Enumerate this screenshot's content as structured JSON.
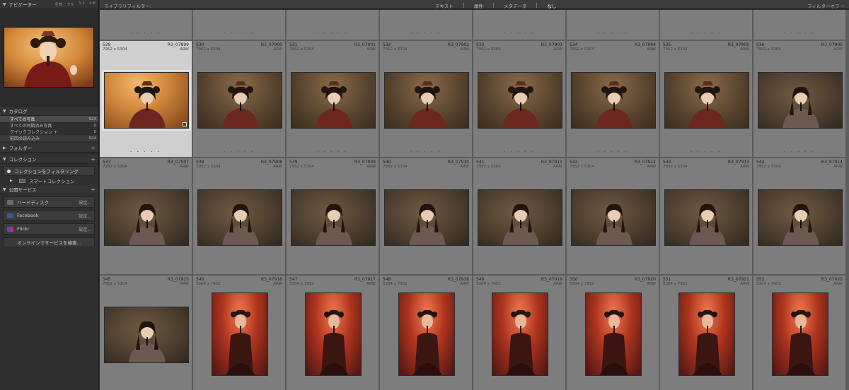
{
  "navigator": {
    "title": "ナビゲーター",
    "options": [
      "全体",
      "フル",
      "1:1",
      "1:8"
    ]
  },
  "catalog": {
    "title": "カタログ",
    "items": [
      {
        "label": "すべての写真",
        "count": "924"
      },
      {
        "label": "すべての同期済み写真",
        "count": "0"
      },
      {
        "label": "クイックコレクション +",
        "count": "0"
      },
      {
        "label": "前回の読み込み",
        "count": "924"
      }
    ]
  },
  "folders": {
    "title": "フォルダー"
  },
  "collections": {
    "title": "コレクション",
    "filter_label": "コレクションをフィルタリング",
    "smart_label": "スマートコレクション"
  },
  "publish": {
    "title": "公開サービス",
    "services": [
      {
        "name": "ハードディスク",
        "setting": "設定...",
        "icon": "hard-disk-icon",
        "color": "#6a6a6a"
      },
      {
        "name": "Facebook",
        "setting": "設定...",
        "icon": "facebook-icon",
        "color": "#3b5998"
      },
      {
        "name": "Flickr",
        "setting": "設定...",
        "icon": "flickr-icon",
        "color": "#d0247a"
      }
    ],
    "find_label": "オンラインでサービスを検索..."
  },
  "filterbar": {
    "title": "ライブラリフィルター:",
    "tabs": [
      "テキスト",
      "属性",
      "メタデータ",
      "なし"
    ],
    "active_tab": "なし",
    "right_label": "フィルターオフ ÷"
  },
  "grid": {
    "columns": 8,
    "rows": [
      [
        {
          "index": "529",
          "name": "R3_07899",
          "dims": "7952 x 5304",
          "ext": "ARW",
          "orientation": "landscape",
          "tone": "hero",
          "selected": true
        },
        {
          "index": "530",
          "name": "R3_07900",
          "dims": "7952 x 5304",
          "ext": "ARW",
          "orientation": "landscape",
          "tone": "warm"
        },
        {
          "index": "531",
          "name": "R3_07901",
          "dims": "7952 x 5304",
          "ext": "ARW",
          "orientation": "landscape",
          "tone": "warm"
        },
        {
          "index": "532",
          "name": "R3_07902",
          "dims": "7952 x 5304",
          "ext": "ARW",
          "orientation": "landscape",
          "tone": "warm"
        },
        {
          "index": "533",
          "name": "R3_07903",
          "dims": "7952 x 5304",
          "ext": "ARW",
          "orientation": "landscape",
          "tone": "warm"
        },
        {
          "index": "534",
          "name": "R3_07904",
          "dims": "7952 x 5304",
          "ext": "ARW",
          "orientation": "landscape",
          "tone": "warm"
        },
        {
          "index": "535",
          "name": "R3_07905",
          "dims": "7952 x 5304",
          "ext": "ARW",
          "orientation": "landscape",
          "tone": "warm"
        },
        {
          "index": "536",
          "name": "R3_07906",
          "dims": "7952 x 5304",
          "ext": "ARW",
          "orientation": "landscape",
          "tone": "stage"
        }
      ],
      [
        {
          "index": "537",
          "name": "R3_07907",
          "dims": "7952 x 5304",
          "ext": "ARW",
          "orientation": "landscape",
          "tone": "stage"
        },
        {
          "index": "538",
          "name": "R3_07908",
          "dims": "7952 x 5304",
          "ext": "ARW",
          "orientation": "landscape",
          "tone": "stage"
        },
        {
          "index": "539",
          "name": "R3_07909",
          "dims": "7952 x 5304",
          "ext": "ARW",
          "orientation": "landscape",
          "tone": "stage"
        },
        {
          "index": "540",
          "name": "R3_07910",
          "dims": "7952 x 5304",
          "ext": "ARW",
          "orientation": "landscape",
          "tone": "stage"
        },
        {
          "index": "541",
          "name": "R3_07911",
          "dims": "7952 x 5304",
          "ext": "ARW",
          "orientation": "landscape",
          "tone": "stage"
        },
        {
          "index": "542",
          "name": "R3_07912",
          "dims": "7952 x 5304",
          "ext": "ARW",
          "orientation": "landscape",
          "tone": "stage"
        },
        {
          "index": "543",
          "name": "R3_07913",
          "dims": "7952 x 5304",
          "ext": "ARW",
          "orientation": "landscape",
          "tone": "stage"
        },
        {
          "index": "544",
          "name": "R3_07914",
          "dims": "7952 x 5304",
          "ext": "ARW",
          "orientation": "landscape",
          "tone": "stage"
        }
      ],
      [
        {
          "index": "545",
          "name": "R3_07915",
          "dims": "7952 x 5304",
          "ext": "ARW",
          "orientation": "landscape",
          "tone": "stage"
        },
        {
          "index": "546",
          "name": "R3_07916",
          "dims": "5304 x 7952",
          "ext": "ARW",
          "orientation": "portrait",
          "tone": "red"
        },
        {
          "index": "547",
          "name": "R3_07917",
          "dims": "5304 x 7952",
          "ext": "ARW",
          "orientation": "portrait",
          "tone": "red"
        },
        {
          "index": "548",
          "name": "R3_07918",
          "dims": "5304 x 7952",
          "ext": "ARW",
          "orientation": "portrait",
          "tone": "red"
        },
        {
          "index": "549",
          "name": "R3_07919",
          "dims": "5304 x 7952",
          "ext": "ARW",
          "orientation": "portrait",
          "tone": "red"
        },
        {
          "index": "550",
          "name": "R3_07920",
          "dims": "5304 x 7952",
          "ext": "ARW",
          "orientation": "portrait",
          "tone": "red"
        },
        {
          "index": "551",
          "name": "R3_07921",
          "dims": "5304 x 7952",
          "ext": "ARW",
          "orientation": "portrait",
          "tone": "red"
        },
        {
          "index": "552",
          "name": "R3_07922",
          "dims": "5304 x 7952",
          "ext": "ARW",
          "orientation": "portrait",
          "tone": "red"
        }
      ]
    ]
  },
  "colors": {
    "panel_bg": "#2f2f2f",
    "grid_bg": "#5e5e5e",
    "cell_bg": "#7d7d7d",
    "cell_selected": "#cfcfcf"
  }
}
